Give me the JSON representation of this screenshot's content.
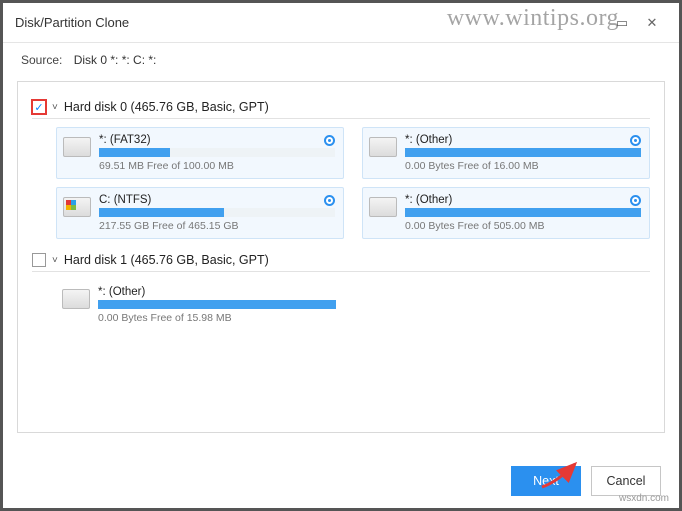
{
  "window": {
    "title": "Disk/Partition Clone",
    "maximize_glyph": "▭",
    "close_glyph": "✕"
  },
  "source": {
    "label": "Source:",
    "value": "Disk 0 *: *: C: *:"
  },
  "disks": [
    {
      "checked": true,
      "highlight": true,
      "chevron": "˅",
      "title": "Hard disk 0 (465.76 GB, Basic, GPT)",
      "partitions": [
        {
          "name": "*: (FAT32)",
          "free_text": "69.51 MB Free of 100.00 MB",
          "used_pct": 30,
          "icon": "plain",
          "selected": true
        },
        {
          "name": "*: (Other)",
          "free_text": "0.00 Bytes Free of 16.00 MB",
          "used_pct": 100,
          "icon": "plain",
          "selected": true
        },
        {
          "name": "C: (NTFS)",
          "free_text": "217.55 GB Free of 465.15 GB",
          "used_pct": 53,
          "icon": "win",
          "selected": true
        },
        {
          "name": "*: (Other)",
          "free_text": "0.00 Bytes Free of 505.00 MB",
          "used_pct": 100,
          "icon": "plain",
          "selected": true
        }
      ]
    },
    {
      "checked": false,
      "highlight": false,
      "chevron": "˅",
      "title": "Hard disk 1 (465.76 GB, Basic, GPT)",
      "partitions": [
        {
          "name": "*: (Other)",
          "free_text": "0.00 Bytes Free of 15.98 MB",
          "used_pct": 100,
          "icon": "plain",
          "selected": false
        }
      ]
    }
  ],
  "footer": {
    "next": "Next",
    "cancel": "Cancel"
  },
  "watermark": {
    "top": "www.wintips.org",
    "bottom": "wsxdn.com"
  }
}
